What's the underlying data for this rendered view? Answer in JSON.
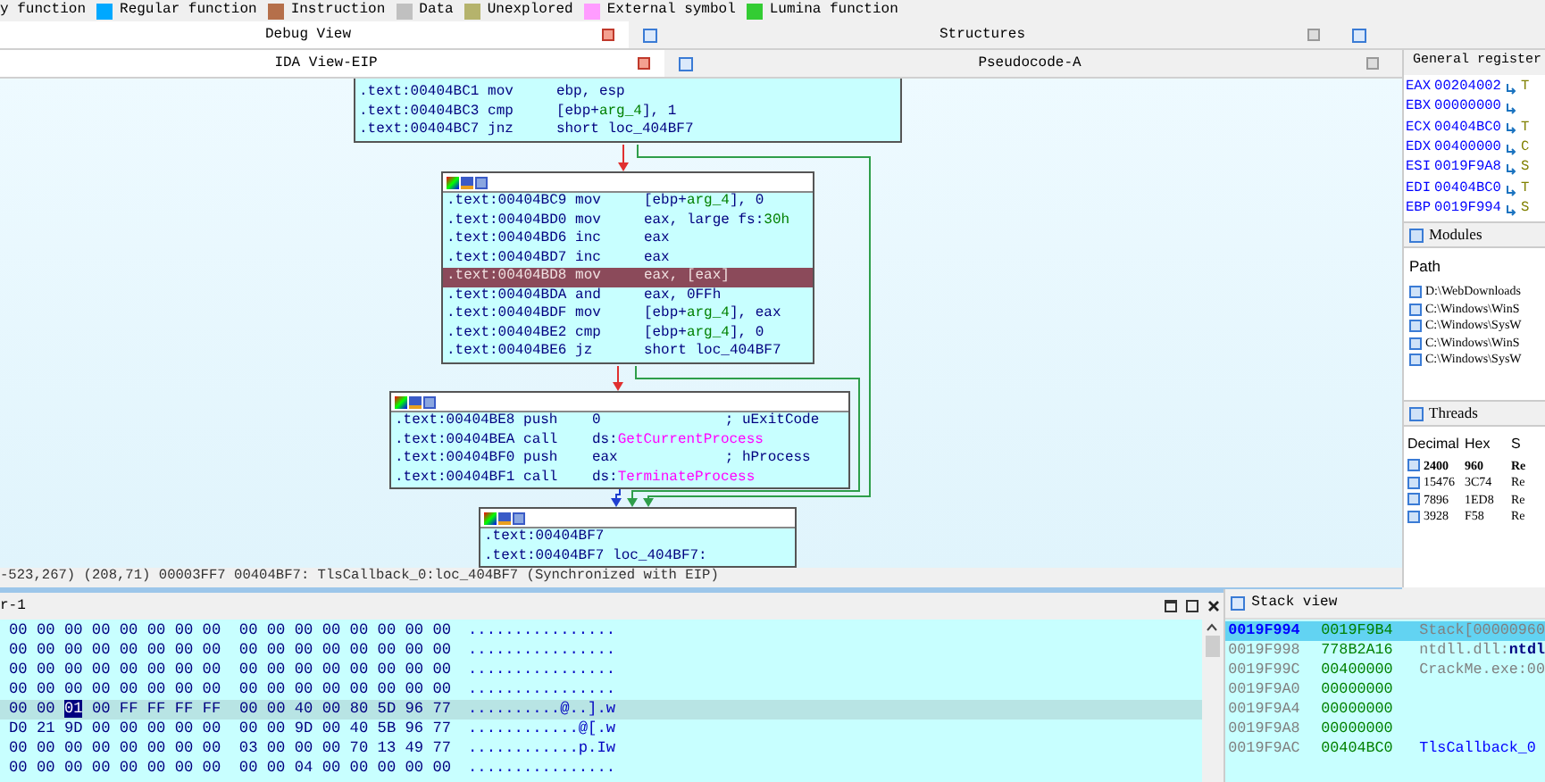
{
  "legend": [
    {
      "label": "y function"
    },
    {
      "label": "Regular function",
      "color": "#00a8ff"
    },
    {
      "label": "Instruction",
      "color": "#b56f4a"
    },
    {
      "label": "Data",
      "color": "#c0c0c0"
    },
    {
      "label": "Unexplored",
      "color": "#b5b36c"
    },
    {
      "label": "External symbol",
      "color": "#ff9cff"
    },
    {
      "label": "Lumina function",
      "color": "#33cc33"
    }
  ],
  "tabs_top": [
    {
      "label": "Debug View",
      "selected": true
    },
    {
      "label": "Structures",
      "selected": false
    }
  ],
  "tabs_main": [
    {
      "label": "IDA View-EIP",
      "selected": true
    },
    {
      "label": "Pseudocode-A",
      "selected": false
    }
  ],
  "graph": {
    "nodes": [
      {
        "header": false,
        "lines": [
          {
            "address": ".text:00404BC1",
            "mnemonic": "mov",
            "operands": [
              {
                "text": "ebp, esp",
                "kind": "plain"
              }
            ],
            "selected": false
          },
          {
            "address": ".text:00404BC3",
            "mnemonic": "cmp",
            "operands": [
              {
                "text": "[ebp+",
                "kind": "plain"
              },
              {
                "text": "arg_4",
                "kind": "var"
              },
              {
                "text": "], 1",
                "kind": "plain"
              }
            ],
            "selected": false
          },
          {
            "address": ".text:00404BC7",
            "mnemonic": "jnz",
            "operands": [
              {
                "text": "short loc_404BF7",
                "kind": "plain"
              }
            ],
            "selected": false
          }
        ]
      },
      {
        "header": true,
        "lines": [
          {
            "address": ".text:00404BC9",
            "mnemonic": "mov",
            "operands": [
              {
                "text": "[ebp+",
                "kind": "plain"
              },
              {
                "text": "arg_4",
                "kind": "var"
              },
              {
                "text": "], 0",
                "kind": "plain"
              }
            ],
            "selected": false
          },
          {
            "address": ".text:00404BD0",
            "mnemonic": "mov",
            "operands": [
              {
                "text": "eax, large fs:",
                "kind": "plain"
              },
              {
                "text": "30h",
                "kind": "var"
              }
            ],
            "selected": false
          },
          {
            "address": ".text:00404BD6",
            "mnemonic": "inc",
            "operands": [
              {
                "text": "eax",
                "kind": "plain"
              }
            ],
            "selected": false
          },
          {
            "address": ".text:00404BD7",
            "mnemonic": "inc",
            "operands": [
              {
                "text": "eax",
                "kind": "plain"
              }
            ],
            "selected": false
          },
          {
            "address": ".text:00404BD8",
            "mnemonic": "mov",
            "operands": [
              {
                "text": "eax, [eax]",
                "kind": "plain"
              }
            ],
            "selected": true
          },
          {
            "address": ".text:00404BDA",
            "mnemonic": "and",
            "operands": [
              {
                "text": "eax, 0FFh",
                "kind": "plain"
              }
            ],
            "selected": false
          },
          {
            "address": ".text:00404BDF",
            "mnemonic": "mov",
            "operands": [
              {
                "text": "[ebp+",
                "kind": "plain"
              },
              {
                "text": "arg_4",
                "kind": "var"
              },
              {
                "text": "], eax",
                "kind": "plain"
              }
            ],
            "selected": false
          },
          {
            "address": ".text:00404BE2",
            "mnemonic": "cmp",
            "operands": [
              {
                "text": "[ebp+",
                "kind": "plain"
              },
              {
                "text": "arg_4",
                "kind": "var"
              },
              {
                "text": "], 0",
                "kind": "plain"
              }
            ],
            "selected": false
          },
          {
            "address": ".text:00404BE6",
            "mnemonic": "jz",
            "operands": [
              {
                "text": "short loc_404BF7",
                "kind": "plain"
              }
            ],
            "selected": false
          }
        ]
      },
      {
        "header": true,
        "lines": [
          {
            "address": ".text:00404BE8",
            "mnemonic": "push",
            "operands": [
              {
                "text": "0",
                "kind": "plain"
              }
            ],
            "comment": "; uExitCode",
            "selected": false
          },
          {
            "address": ".text:00404BEA",
            "mnemonic": "call",
            "operands": [
              {
                "text": "ds:",
                "kind": "plain"
              },
              {
                "text": "GetCurrentProcess",
                "kind": "import"
              }
            ],
            "selected": false
          },
          {
            "address": ".text:00404BF0",
            "mnemonic": "push",
            "operands": [
              {
                "text": "eax",
                "kind": "plain"
              }
            ],
            "comment": "; hProcess",
            "selected": false
          },
          {
            "address": ".text:00404BF1",
            "mnemonic": "call",
            "operands": [
              {
                "text": "ds:",
                "kind": "plain"
              },
              {
                "text": "TerminateProcess",
                "kind": "import"
              }
            ],
            "selected": false
          }
        ]
      },
      {
        "header": true,
        "lines": [
          {
            "address": ".text:00404BF7",
            "selected": false
          },
          {
            "address": ".text:00404BF7",
            "label": "loc_404BF7:",
            "selected": false
          }
        ]
      }
    ],
    "edges": [
      {
        "kind": "false"
      },
      {
        "kind": "true"
      },
      {
        "kind": "false"
      },
      {
        "kind": "true"
      },
      {
        "kind": "flow"
      }
    ]
  },
  "status_line": "-523,267) (208,71) 00003FF7 00404BF7: TlsCallback_0:loc_404BF7 (Synchronized with EIP)",
  "hex_view": {
    "title": "r-1",
    "rows": [
      {
        "hex": "00 00 00 00 00 00 00 00  00 00 00 00 00 00 00 00",
        "ascii": "................",
        "selected": false
      },
      {
        "hex": "00 00 00 00 00 00 00 00  00 00 00 00 00 00 00 00",
        "ascii": "................",
        "selected": false
      },
      {
        "hex": "00 00 00 00 00 00 00 00  00 00 00 00 00 00 00 00",
        "ascii": "................",
        "selected": false
      },
      {
        "hex": "00 00 00 00 00 00 00 00  00 00 00 00 00 00 00 00",
        "ascii": "................",
        "selected": false
      },
      {
        "hex_before": "00 00 ",
        "cursor": "01",
        "hex_after": " 00 FF FF FF FF  00 00 40 00 80 5D 96 77",
        "ascii": "..........@..].w",
        "selected": true
      },
      {
        "hex": "D0 21 9D 00 00 00 00 00  00 00 9D 00 40 5B 96 77",
        "ascii": "............@[.w",
        "selected": false
      },
      {
        "hex": "00 00 00 00 00 00 00 00  03 00 00 00 70 13 49 77",
        "ascii": "............p.Iw",
        "selected": false
      },
      {
        "hex": "00 00 00 00 00 00 00 00  00 00 04 00 00 00 00 00",
        "ascii": "................",
        "selected": false
      }
    ]
  },
  "registers": {
    "title": "General register",
    "rows": [
      {
        "name": "EAX",
        "value": "00204002",
        "hint": "T"
      },
      {
        "name": "EBX",
        "value": "00000000"
      },
      {
        "name": "ECX",
        "value": "00404BC0",
        "hint": "T"
      },
      {
        "name": "EDX",
        "value": "00400000",
        "hint": "C"
      },
      {
        "name": "ESI",
        "value": "0019F9A8",
        "hint": "S"
      },
      {
        "name": "EDI",
        "value": "00404BC0",
        "hint": "T"
      },
      {
        "name": "EBP",
        "value": "0019F994",
        "hint": "S"
      }
    ]
  },
  "modules": {
    "title": "Modules",
    "column": "Path",
    "items": [
      "D:\\WebDownloads",
      "C:\\Windows\\WinS",
      "C:\\Windows\\SysW",
      "C:\\Windows\\WinS",
      "C:\\Windows\\SysW"
    ]
  },
  "threads": {
    "title": "Threads",
    "columns": [
      "Decimal",
      "Hex",
      "S"
    ],
    "rows": [
      {
        "cells": [
          "2400",
          "960",
          "Re"
        ],
        "current": true
      },
      {
        "cells": [
          "15476",
          "3C74",
          "Re"
        ],
        "current": false
      },
      {
        "cells": [
          "7896",
          "1ED8",
          "Re"
        ],
        "current": false
      },
      {
        "cells": [
          "3928",
          "F58",
          "Re"
        ],
        "current": false
      }
    ]
  },
  "stack_view": {
    "title": "Stack view",
    "rows": [
      {
        "address": "0019F994",
        "value": "0019F9B4",
        "info": "Stack[00000960",
        "kind": "plain",
        "selected": true
      },
      {
        "address": "0019F998",
        "value": "778B2A16",
        "info": "ntdll.dll:**ntdl**",
        "kind": "plain",
        "selected": false
      },
      {
        "address": "0019F99C",
        "value": "00400000",
        "info": "CrackMe.exe:00",
        "kind": "plain",
        "selected": false
      },
      {
        "address": "0019F9A0",
        "value": "00000000",
        "selected": false
      },
      {
        "address": "0019F9A4",
        "value": "00000000",
        "selected": false
      },
      {
        "address": "0019F9A8",
        "value": "00000000",
        "selected": false
      },
      {
        "address": "0019F9AC",
        "value": "00404BC0",
        "info": "TlsCallback_0",
        "kind": "label",
        "selected": false
      }
    ]
  }
}
